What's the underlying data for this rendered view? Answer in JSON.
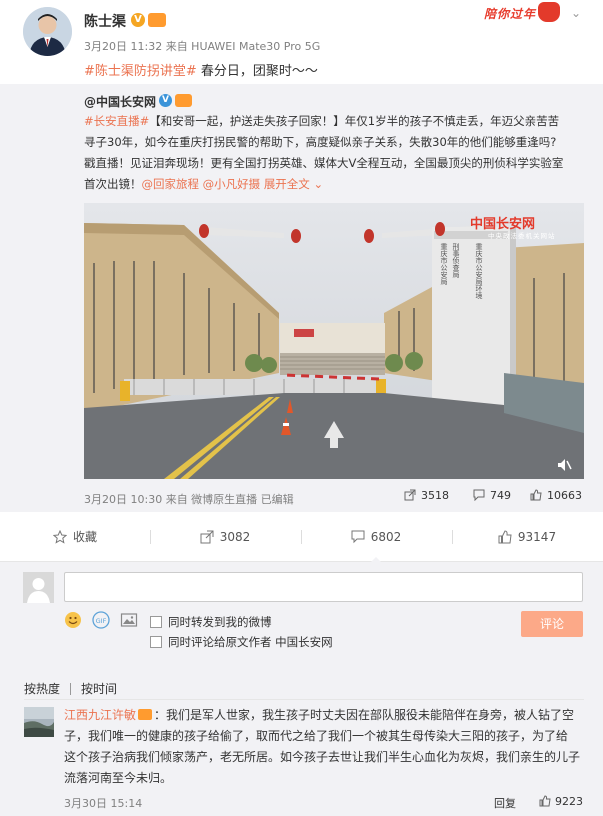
{
  "post": {
    "author": "陈士渠",
    "badge_text": "陪你过年",
    "meta": "3月20日 11:32 来自 HUAWEI Mate30 Pro 5G",
    "hashtag": "#陈士渠防拐讲堂#",
    "text": " 春分日，团聚时～～"
  },
  "repost": {
    "author": "@中国长安网",
    "hashtag": "#长安直播#",
    "line1_rest": "【和安哥一起，护送走失孩子回家！】年仅1岁半的孩子不慎走丢，年迈父亲苦苦",
    "line2": "寻子30年，如今在重庆打拐民警的帮助下，高度疑似亲子关系，失散30年的他们能够重逢吗?",
    "line3": "戳直播！见证泪奔现场！更有全国打拐英雄、媒体大V全程互动，全国最顶尖的刑侦科学实验室",
    "line4_prefix": "首次出镜！",
    "mention1": "@回家旅程",
    "mention2": "@小凡好摄",
    "expand": "展开全文",
    "video_logo": "中国长安网",
    "video_logo_sub": "中央政法委机关网站",
    "meta": "3月20日 10:30 来自 微博原生直播",
    "edit_label": "已编辑",
    "shares": "3518",
    "comments": "749",
    "likes": "10663"
  },
  "actions": {
    "favorite": "收藏",
    "repost": "3082",
    "comment": "6802",
    "like": "93147"
  },
  "composer": {
    "input_value": "",
    "option1": "同时转发到我的微博",
    "option2": "同时评论给原文作者 中国长安网",
    "submit": "评论"
  },
  "sort": {
    "hot": "按热度",
    "time": "按时间"
  },
  "comment": {
    "author": "江西九江许敏",
    "line1_rest": "：我们是军人世家，我生孩子时丈夫因在部队服役未能陪伴在身旁，被人钻了空",
    "line2": "子，我们唯一的健康的孩子给偷了，取而代之给了我们一个被其生母传染大三阳的孩子，为了给",
    "line3": "这个孩子治病我们倾家荡产，老无所居。如今孩子去世让我们半生心血化为灰烬，我们亲生的儿子",
    "line4": "流落河南至今未归。",
    "time": "3月30日 15:14",
    "reply": "回复",
    "likes": "9223"
  },
  "colors": {
    "accent": "#eb7350",
    "submit_disabled": "#fca988",
    "background": "#f2f2f5"
  }
}
